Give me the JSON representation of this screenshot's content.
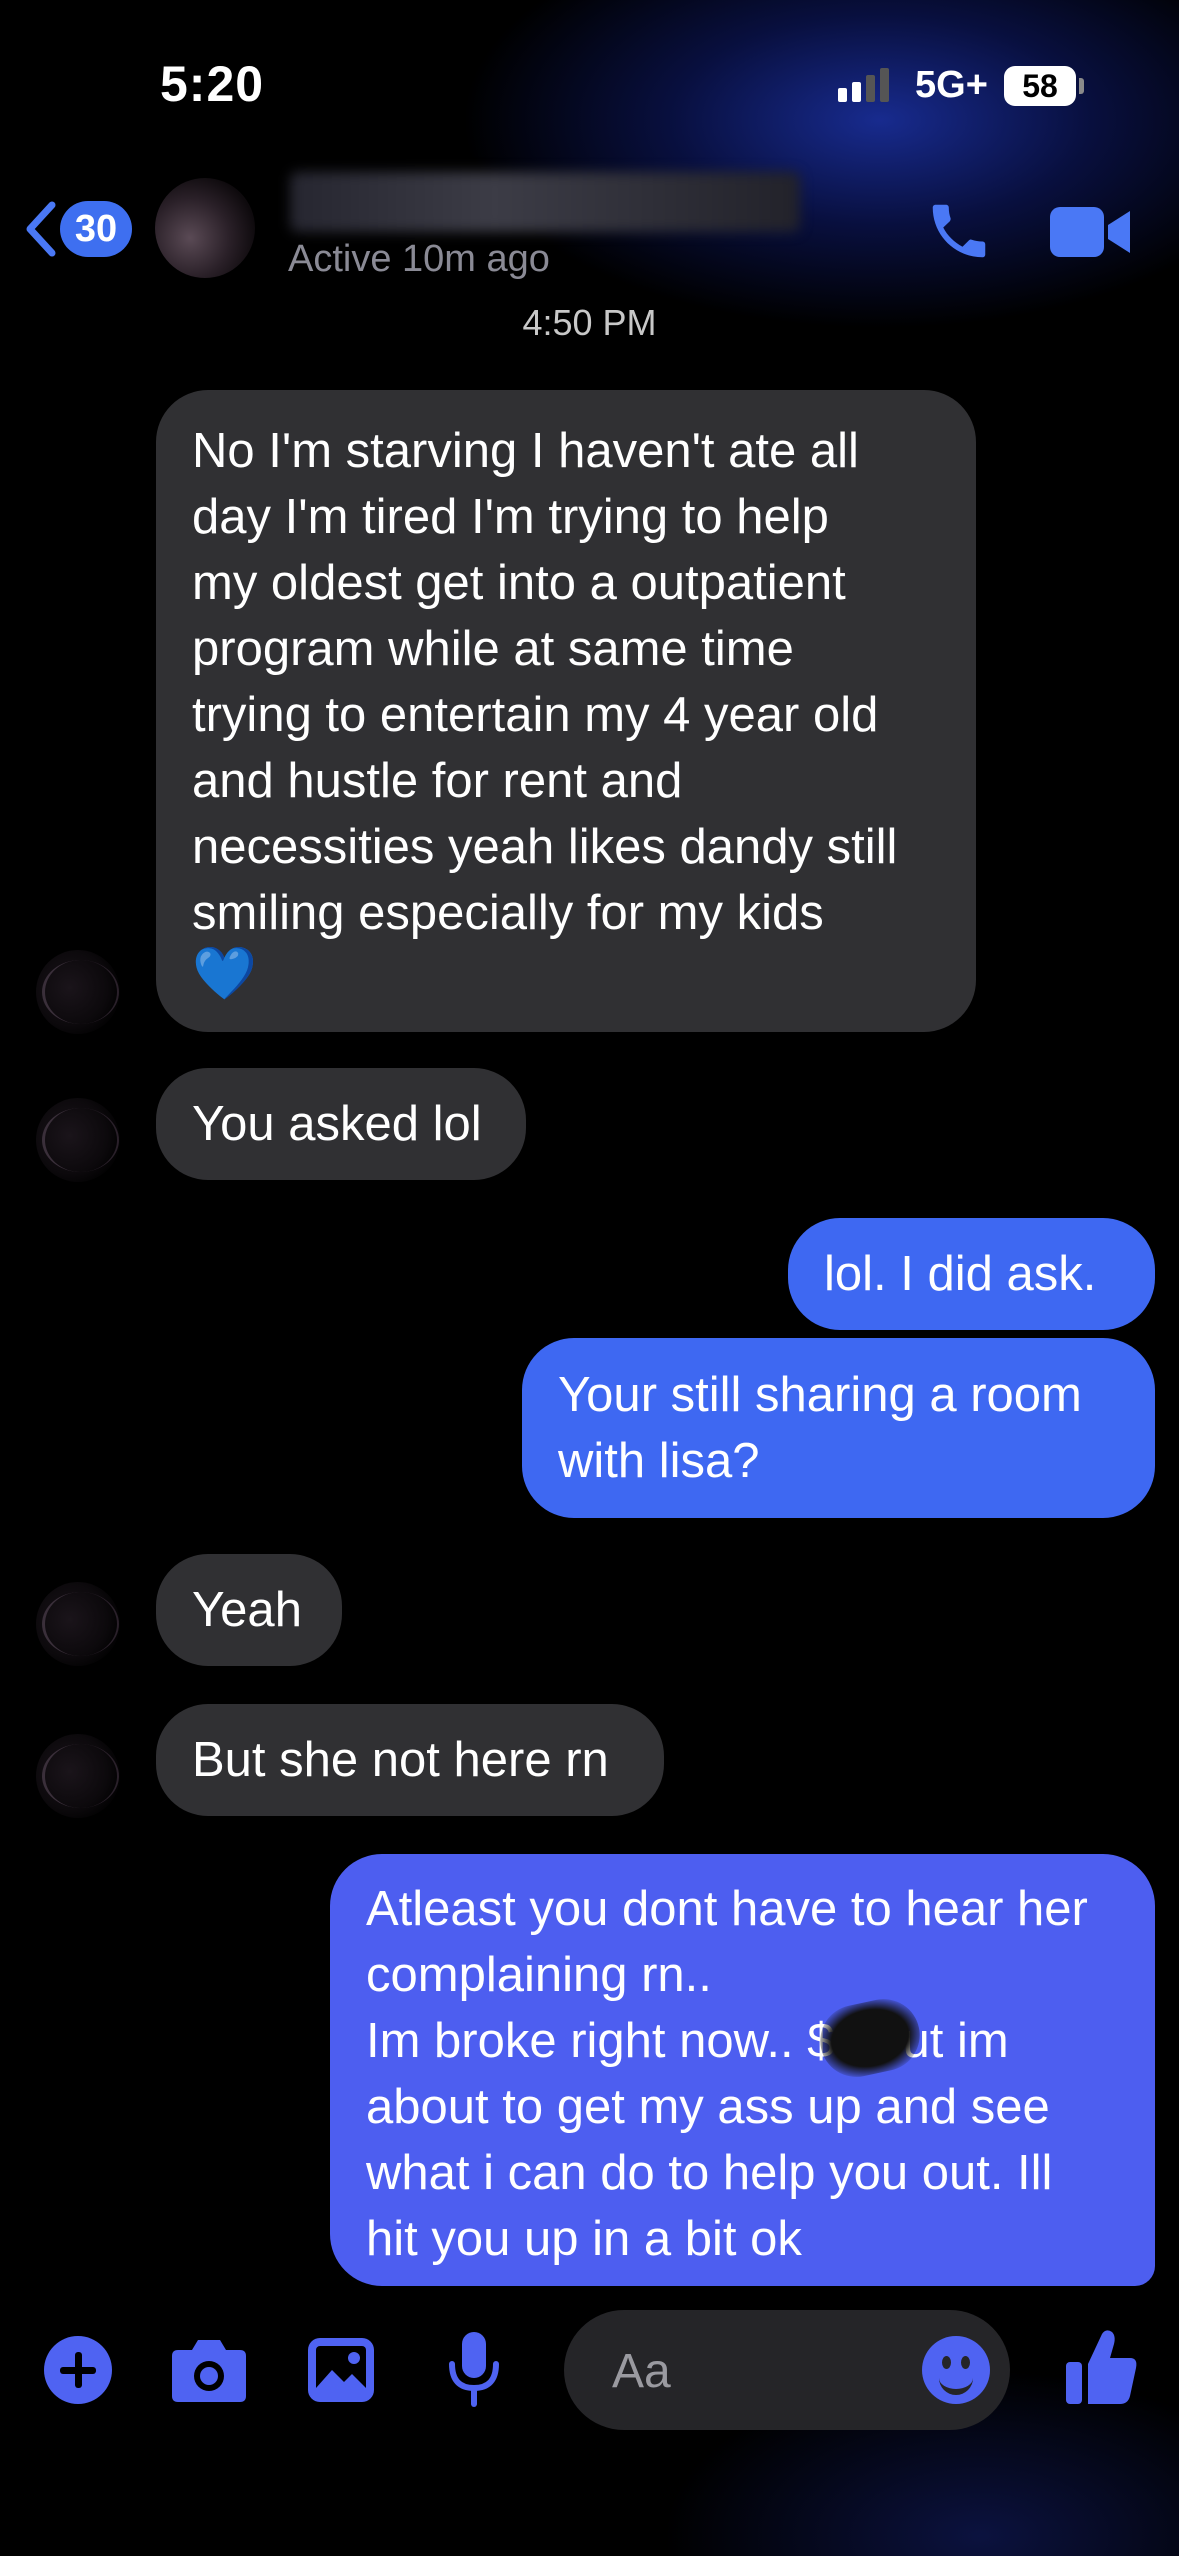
{
  "status_bar": {
    "time": "5:20",
    "network": "5G+",
    "battery": "58"
  },
  "header": {
    "back_count": "30",
    "active_status": "Active 10m ago",
    "icons": [
      "back-chevron-icon",
      "phone-icon",
      "video-camera-icon"
    ]
  },
  "timestamp": "4:50 PM",
  "messages": [
    {
      "side": "received",
      "text": "No I'm starving I haven't ate all\nday I'm tired I'm trying to help\nmy oldest get into a outpatient\nprogram while at same time\ntrying to entertain my 4 year old\nand hustle for rent and\nnecessities yeah likes dandy still\nsmiling  especially for my kids",
      "emoji": "💙"
    },
    {
      "side": "received",
      "text": "You asked lol"
    },
    {
      "side": "sent",
      "text": "lol.  I did ask."
    },
    {
      "side": "sent",
      "text": "Your still sharing a room\nwith lisa?"
    },
    {
      "side": "received",
      "text": "Yeah"
    },
    {
      "side": "received",
      "text": "But she not here rn"
    },
    {
      "side": "sent",
      "text": "Atleast you dont have to hear her\ncomplaining rn..\n Im broke right now..  $0 but im\nabout to get my ass up and see\nwhat i can do to help you out. Ill\nhit you up in a bit ok"
    }
  ],
  "composer": {
    "placeholder": "Aa",
    "icons": [
      "plus-icon",
      "camera-icon",
      "gallery-icon",
      "microphone-icon",
      "emoji-icon",
      "thumbs-up-icon"
    ]
  },
  "colors": {
    "sent_bubble": "#3e68f2",
    "received_bubble": "#303033",
    "accent": "#4f63f2"
  }
}
